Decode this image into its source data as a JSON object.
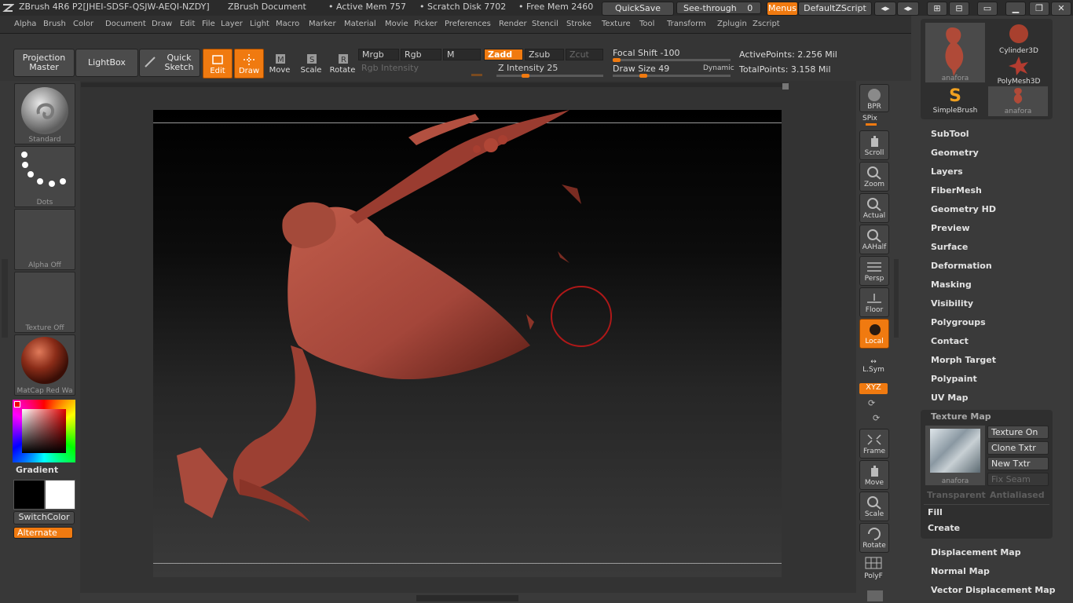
{
  "titlebar": {
    "app_title": "ZBrush 4R6  P2[JHEI-SDSF-QSJW-AEQI-NZDY]",
    "document": "ZBrush Document",
    "active_mem": "• Active Mem 757",
    "scratch_disk": "• Scratch Disk 7702",
    "free_mem": "• Free Mem 2460",
    "quicksave": "QuickSave",
    "see_through": "See-through",
    "see_through_value": "0",
    "menus": "Menus",
    "default_zscript": "DefaultZScript"
  },
  "menubar": [
    "Alpha",
    "Brush",
    "Color",
    "Document",
    "Draw",
    "Edit",
    "File",
    "Layer",
    "Light",
    "Macro",
    "Marker",
    "Material",
    "Movie",
    "Picker",
    "Preferences",
    "Render",
    "Stencil",
    "Stroke",
    "Texture",
    "Tool",
    "Transform",
    "Zplugin",
    "Zscript"
  ],
  "toolbar": {
    "projection_master": "Projection Master",
    "lightbox": "LightBox",
    "quick_sketch": "Quick Sketch",
    "edit": "Edit",
    "draw": "Draw",
    "move": "Move",
    "scale": "Scale",
    "rotate": "Rotate",
    "mrgb": "Mrgb",
    "rgb": "Rgb",
    "m": "M",
    "zadd": "Zadd",
    "zsub": "Zsub",
    "zcut": "Zcut",
    "rgb_intensity": "Rgb Intensity",
    "z_intensity": "Z Intensity 25",
    "focal_shift": "Focal Shift -100",
    "draw_size": "Draw Size 49",
    "dynamic": "Dynamic",
    "active_points": "ActivePoints: 2.256  Mil",
    "total_points": "TotalPoints: 3.158  Mil",
    "z_intensity_level": 0.25,
    "focal_shift_level": 0.0,
    "draw_size_level": 0.24
  },
  "leftpanel": {
    "brush": "Standard",
    "stroke": "Dots",
    "alpha": "Alpha  Off",
    "texture": "Texture  Off",
    "material": "MatCap  Red  Wa",
    "gradient": "Gradient",
    "switch_color": "SwitchColor",
    "alternate": "Alternate"
  },
  "rightshelf": {
    "bpr": "BPR",
    "spix": "SPix",
    "scroll": "Scroll",
    "zoom": "Zoom",
    "actual": "Actual",
    "aahalf": "AAHalf",
    "persp": "Persp",
    "floor": "Floor",
    "local": "Local",
    "lsym": "L.Sym",
    "xyz": "XYZ",
    "frame": "Frame",
    "move": "Move",
    "scale": "Scale",
    "rotate": "Rotate",
    "polyf": "PolyF"
  },
  "tool_palette": {
    "thumbs": [
      "anafora",
      "Cylinder3D",
      "PolyMesh3D",
      "SimpleBrush",
      "anafora"
    ],
    "items": [
      "SubTool",
      "Geometry",
      "Layers",
      "FiberMesh",
      "Geometry HD",
      "Preview",
      "Surface",
      "Deformation",
      "Masking",
      "Visibility",
      "Polygroups",
      "Contact",
      "Morph Target",
      "Polypaint",
      "UV Map"
    ],
    "texture_map": {
      "title": "Texture Map",
      "texture_on": "Texture On",
      "clone_txtr": "Clone Txtr",
      "new_txtr": "New Txtr",
      "fix_seam": "Fix Seam",
      "thumb_label": "anafora",
      "transparent": "Transparent",
      "antialiased": "Antialiased",
      "fill": "Fill",
      "create": "Create"
    },
    "after_items": [
      "Displacement Map",
      "Normal Map",
      "Vector Displacement Map"
    ]
  },
  "colors": {
    "accent": "#f07a10",
    "model": "#a4463a",
    "brush_ring": "#b01818"
  }
}
